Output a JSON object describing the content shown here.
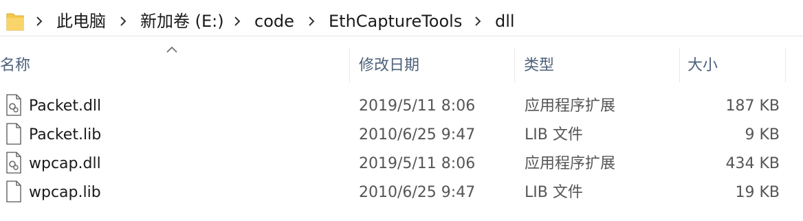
{
  "address": {
    "folder_icon": "folder-icon",
    "crumbs": [
      "此电脑",
      "新加卷 (E:)",
      "code",
      "EthCaptureTools",
      "dll"
    ]
  },
  "columns": {
    "name": "名称",
    "modified": "修改日期",
    "type": "类型",
    "size": "大小",
    "sort": "ascending"
  },
  "files": [
    {
      "name": "Packet.dll",
      "modified": "2019/5/11 8:06",
      "type": "应用程序扩展",
      "size": "187 KB",
      "icon": "dll-file-icon"
    },
    {
      "name": "Packet.lib",
      "modified": "2010/6/25 9:47",
      "type": "LIB 文件",
      "size": "9 KB",
      "icon": "generic-file-icon"
    },
    {
      "name": "wpcap.dll",
      "modified": "2019/5/11 8:06",
      "type": "应用程序扩展",
      "size": "434 KB",
      "icon": "dll-file-icon"
    },
    {
      "name": "wpcap.lib",
      "modified": "2010/6/25 9:47",
      "type": "LIB 文件",
      "size": "19 KB",
      "icon": "generic-file-icon"
    }
  ],
  "colors": {
    "folder": "#f5c84c",
    "header_text": "#4c607a"
  }
}
